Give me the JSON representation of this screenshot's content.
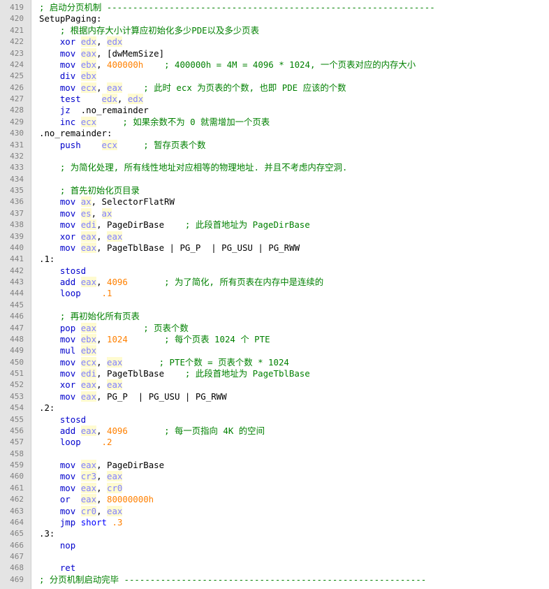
{
  "editor": {
    "title": "",
    "colors": {
      "keyword": "#0000cc",
      "register": "#8080ff",
      "register_bg": "#fffbd0",
      "number": "#ff8000",
      "comment": "#008000",
      "gutter": "#e4e4e4",
      "line_number": "#808080"
    },
    "lines": [
      {
        "n": "419",
        "t": [
          {
            "c": "cmt",
            "v": "; 启动分页机制 ---------------------------------------------------------------"
          }
        ]
      },
      {
        "n": "420",
        "t": [
          {
            "c": "lbl",
            "v": "SetupPaging:"
          }
        ]
      },
      {
        "n": "421",
        "t": [
          {
            "c": "",
            "v": "    "
          },
          {
            "c": "cmt",
            "v": "; 根据内存大小计算应初始化多少PDE以及多少页表"
          }
        ]
      },
      {
        "n": "422",
        "t": [
          {
            "c": "",
            "v": "    "
          },
          {
            "c": "kw",
            "v": "xor"
          },
          {
            "c": "",
            "v": " "
          },
          {
            "c": "reg",
            "v": "edx"
          },
          {
            "c": "",
            "v": ", "
          },
          {
            "c": "reg",
            "v": "edx"
          }
        ]
      },
      {
        "n": "423",
        "t": [
          {
            "c": "",
            "v": "    "
          },
          {
            "c": "kw",
            "v": "mov"
          },
          {
            "c": "",
            "v": " "
          },
          {
            "c": "reg",
            "v": "eax"
          },
          {
            "c": "",
            "v": ", [dwMemSize]"
          }
        ]
      },
      {
        "n": "424",
        "t": [
          {
            "c": "",
            "v": "    "
          },
          {
            "c": "kw",
            "v": "mov"
          },
          {
            "c": "",
            "v": " "
          },
          {
            "c": "reg",
            "v": "ebx"
          },
          {
            "c": "",
            "v": ", "
          },
          {
            "c": "num",
            "v": "400000h"
          },
          {
            "c": "",
            "v": "    "
          },
          {
            "c": "cmt",
            "v": "; 400000h = 4M = 4096 * 1024, 一个页表对应的内存大小"
          }
        ]
      },
      {
        "n": "425",
        "t": [
          {
            "c": "",
            "v": "    "
          },
          {
            "c": "kw",
            "v": "div"
          },
          {
            "c": "",
            "v": " "
          },
          {
            "c": "reg",
            "v": "ebx"
          }
        ]
      },
      {
        "n": "426",
        "t": [
          {
            "c": "",
            "v": "    "
          },
          {
            "c": "kw",
            "v": "mov"
          },
          {
            "c": "",
            "v": " "
          },
          {
            "c": "reg",
            "v": "ecx"
          },
          {
            "c": "",
            "v": ", "
          },
          {
            "c": "reg",
            "v": "eax"
          },
          {
            "c": "",
            "v": "    "
          },
          {
            "c": "cmt",
            "v": "; 此时 ecx 为页表的个数, 也即 PDE 应该的个数"
          }
        ]
      },
      {
        "n": "427",
        "t": [
          {
            "c": "",
            "v": "    "
          },
          {
            "c": "kw",
            "v": "test"
          },
          {
            "c": "",
            "v": "    "
          },
          {
            "c": "reg",
            "v": "edx"
          },
          {
            "c": "",
            "v": ", "
          },
          {
            "c": "reg",
            "v": "edx"
          }
        ]
      },
      {
        "n": "428",
        "t": [
          {
            "c": "",
            "v": "    "
          },
          {
            "c": "kw",
            "v": "jz"
          },
          {
            "c": "",
            "v": "  .no_remainder"
          }
        ]
      },
      {
        "n": "429",
        "t": [
          {
            "c": "",
            "v": "    "
          },
          {
            "c": "kw",
            "v": "inc"
          },
          {
            "c": "",
            "v": " "
          },
          {
            "c": "reg",
            "v": "ecx"
          },
          {
            "c": "",
            "v": "     "
          },
          {
            "c": "cmt",
            "v": "; 如果余数不为 0 就需增加一个页表"
          }
        ]
      },
      {
        "n": "430",
        "t": [
          {
            "c": "lbl",
            "v": ".no_remainder:"
          }
        ]
      },
      {
        "n": "431",
        "t": [
          {
            "c": "",
            "v": "    "
          },
          {
            "c": "kw",
            "v": "push"
          },
          {
            "c": "",
            "v": "    "
          },
          {
            "c": "reg",
            "v": "ecx"
          },
          {
            "c": "",
            "v": "     "
          },
          {
            "c": "cmt",
            "v": "; 暂存页表个数"
          }
        ]
      },
      {
        "n": "432",
        "t": []
      },
      {
        "n": "433",
        "t": [
          {
            "c": "",
            "v": "    "
          },
          {
            "c": "cmt",
            "v": "; 为简化处理, 所有线性地址对应相等的物理地址. 并且不考虑内存空洞."
          }
        ]
      },
      {
        "n": "434",
        "t": []
      },
      {
        "n": "435",
        "t": [
          {
            "c": "",
            "v": "    "
          },
          {
            "c": "cmt",
            "v": "; 首先初始化页目录"
          }
        ]
      },
      {
        "n": "436",
        "t": [
          {
            "c": "",
            "v": "    "
          },
          {
            "c": "kw",
            "v": "mov"
          },
          {
            "c": "",
            "v": " "
          },
          {
            "c": "reg",
            "v": "ax"
          },
          {
            "c": "",
            "v": ", SelectorFlatRW"
          }
        ]
      },
      {
        "n": "437",
        "t": [
          {
            "c": "",
            "v": "    "
          },
          {
            "c": "kw",
            "v": "mov"
          },
          {
            "c": "",
            "v": " "
          },
          {
            "c": "reg",
            "v": "es"
          },
          {
            "c": "",
            "v": ", "
          },
          {
            "c": "reg",
            "v": "ax"
          }
        ]
      },
      {
        "n": "438",
        "t": [
          {
            "c": "",
            "v": "    "
          },
          {
            "c": "kw",
            "v": "mov"
          },
          {
            "c": "",
            "v": " "
          },
          {
            "c": "reg",
            "v": "edi"
          },
          {
            "c": "",
            "v": ", PageDirBase    "
          },
          {
            "c": "cmt",
            "v": "; 此段首地址为 PageDirBase"
          }
        ]
      },
      {
        "n": "439",
        "t": [
          {
            "c": "",
            "v": "    "
          },
          {
            "c": "kw",
            "v": "xor"
          },
          {
            "c": "",
            "v": " "
          },
          {
            "c": "reg",
            "v": "eax"
          },
          {
            "c": "",
            "v": ", "
          },
          {
            "c": "reg",
            "v": "eax"
          }
        ]
      },
      {
        "n": "440",
        "t": [
          {
            "c": "",
            "v": "    "
          },
          {
            "c": "kw",
            "v": "mov"
          },
          {
            "c": "",
            "v": " "
          },
          {
            "c": "reg",
            "v": "eax"
          },
          {
            "c": "",
            "v": ", PageTblBase | PG_P  | PG_USU | PG_RWW"
          }
        ]
      },
      {
        "n": "441",
        "t": [
          {
            "c": "lbl",
            "v": ".1:"
          }
        ]
      },
      {
        "n": "442",
        "t": [
          {
            "c": "",
            "v": "    "
          },
          {
            "c": "kw",
            "v": "stosd"
          }
        ]
      },
      {
        "n": "443",
        "t": [
          {
            "c": "",
            "v": "    "
          },
          {
            "c": "kw",
            "v": "add"
          },
          {
            "c": "",
            "v": " "
          },
          {
            "c": "reg",
            "v": "eax"
          },
          {
            "c": "",
            "v": ", "
          },
          {
            "c": "num",
            "v": "4096"
          },
          {
            "c": "",
            "v": "       "
          },
          {
            "c": "cmt",
            "v": "; 为了简化, 所有页表在内存中是连续的"
          }
        ]
      },
      {
        "n": "444",
        "t": [
          {
            "c": "",
            "v": "    "
          },
          {
            "c": "kw",
            "v": "loop"
          },
          {
            "c": "",
            "v": "    "
          },
          {
            "c": "num",
            "v": ".1"
          }
        ]
      },
      {
        "n": "445",
        "t": []
      },
      {
        "n": "446",
        "t": [
          {
            "c": "",
            "v": "    "
          },
          {
            "c": "cmt",
            "v": "; 再初始化所有页表"
          }
        ]
      },
      {
        "n": "447",
        "t": [
          {
            "c": "",
            "v": "    "
          },
          {
            "c": "kw",
            "v": "pop"
          },
          {
            "c": "",
            "v": " "
          },
          {
            "c": "reg",
            "v": "eax"
          },
          {
            "c": "",
            "v": "         "
          },
          {
            "c": "cmt",
            "v": "; 页表个数"
          }
        ]
      },
      {
        "n": "448",
        "t": [
          {
            "c": "",
            "v": "    "
          },
          {
            "c": "kw",
            "v": "mov"
          },
          {
            "c": "",
            "v": " "
          },
          {
            "c": "reg",
            "v": "ebx"
          },
          {
            "c": "",
            "v": ", "
          },
          {
            "c": "num",
            "v": "1024"
          },
          {
            "c": "",
            "v": "       "
          },
          {
            "c": "cmt",
            "v": "; 每个页表 1024 个 PTE"
          }
        ]
      },
      {
        "n": "449",
        "t": [
          {
            "c": "",
            "v": "    "
          },
          {
            "c": "kw",
            "v": "mul"
          },
          {
            "c": "",
            "v": " "
          },
          {
            "c": "reg",
            "v": "ebx"
          }
        ]
      },
      {
        "n": "450",
        "t": [
          {
            "c": "",
            "v": "    "
          },
          {
            "c": "kw",
            "v": "mov"
          },
          {
            "c": "",
            "v": " "
          },
          {
            "c": "reg",
            "v": "ecx"
          },
          {
            "c": "",
            "v": ", "
          },
          {
            "c": "reg",
            "v": "eax"
          },
          {
            "c": "",
            "v": "       "
          },
          {
            "c": "cmt",
            "v": "; PTE个数 = 页表个数 * 1024"
          }
        ]
      },
      {
        "n": "451",
        "t": [
          {
            "c": "",
            "v": "    "
          },
          {
            "c": "kw",
            "v": "mov"
          },
          {
            "c": "",
            "v": " "
          },
          {
            "c": "reg",
            "v": "edi"
          },
          {
            "c": "",
            "v": ", PageTblBase    "
          },
          {
            "c": "cmt",
            "v": "; 此段首地址为 PageTblBase"
          }
        ]
      },
      {
        "n": "452",
        "t": [
          {
            "c": "",
            "v": "    "
          },
          {
            "c": "kw",
            "v": "xor"
          },
          {
            "c": "",
            "v": " "
          },
          {
            "c": "reg",
            "v": "eax"
          },
          {
            "c": "",
            "v": ", "
          },
          {
            "c": "reg",
            "v": "eax"
          }
        ]
      },
      {
        "n": "453",
        "t": [
          {
            "c": "",
            "v": "    "
          },
          {
            "c": "kw",
            "v": "mov"
          },
          {
            "c": "",
            "v": " "
          },
          {
            "c": "reg",
            "v": "eax"
          },
          {
            "c": "",
            "v": ", PG_P  | PG_USU | PG_RWW"
          }
        ]
      },
      {
        "n": "454",
        "t": [
          {
            "c": "lbl",
            "v": ".2:"
          }
        ]
      },
      {
        "n": "455",
        "t": [
          {
            "c": "",
            "v": "    "
          },
          {
            "c": "kw",
            "v": "stosd"
          }
        ]
      },
      {
        "n": "456",
        "t": [
          {
            "c": "",
            "v": "    "
          },
          {
            "c": "kw",
            "v": "add"
          },
          {
            "c": "",
            "v": " "
          },
          {
            "c": "reg",
            "v": "eax"
          },
          {
            "c": "",
            "v": ", "
          },
          {
            "c": "num",
            "v": "4096"
          },
          {
            "c": "",
            "v": "       "
          },
          {
            "c": "cmt",
            "v": "; 每一页指向 4K 的空间"
          }
        ]
      },
      {
        "n": "457",
        "t": [
          {
            "c": "",
            "v": "    "
          },
          {
            "c": "kw",
            "v": "loop"
          },
          {
            "c": "",
            "v": "    "
          },
          {
            "c": "num",
            "v": ".2"
          }
        ]
      },
      {
        "n": "458",
        "t": []
      },
      {
        "n": "459",
        "t": [
          {
            "c": "",
            "v": "    "
          },
          {
            "c": "kw",
            "v": "mov"
          },
          {
            "c": "",
            "v": " "
          },
          {
            "c": "reg",
            "v": "eax"
          },
          {
            "c": "",
            "v": ", PageDirBase"
          }
        ]
      },
      {
        "n": "460",
        "t": [
          {
            "c": "",
            "v": "    "
          },
          {
            "c": "kw",
            "v": "mov"
          },
          {
            "c": "",
            "v": " "
          },
          {
            "c": "reg",
            "v": "cr3"
          },
          {
            "c": "",
            "v": ", "
          },
          {
            "c": "reg",
            "v": "eax"
          }
        ]
      },
      {
        "n": "461",
        "t": [
          {
            "c": "",
            "v": "    "
          },
          {
            "c": "kw",
            "v": "mov"
          },
          {
            "c": "",
            "v": " "
          },
          {
            "c": "reg",
            "v": "eax"
          },
          {
            "c": "",
            "v": ", "
          },
          {
            "c": "reg",
            "v": "cr0"
          }
        ]
      },
      {
        "n": "462",
        "t": [
          {
            "c": "",
            "v": "    "
          },
          {
            "c": "kw",
            "v": "or"
          },
          {
            "c": "",
            "v": "  "
          },
          {
            "c": "reg",
            "v": "eax"
          },
          {
            "c": "",
            "v": ", "
          },
          {
            "c": "num",
            "v": "80000000h"
          }
        ]
      },
      {
        "n": "463",
        "t": [
          {
            "c": "",
            "v": "    "
          },
          {
            "c": "kw",
            "v": "mov"
          },
          {
            "c": "",
            "v": " "
          },
          {
            "c": "reg",
            "v": "cr0"
          },
          {
            "c": "",
            "v": ", "
          },
          {
            "c": "reg",
            "v": "eax"
          }
        ]
      },
      {
        "n": "464",
        "t": [
          {
            "c": "",
            "v": "    "
          },
          {
            "c": "kw",
            "v": "jmp"
          },
          {
            "c": "",
            "v": " "
          },
          {
            "c": "bt",
            "v": "short"
          },
          {
            "c": "",
            "v": " "
          },
          {
            "c": "num",
            "v": ".3"
          }
        ]
      },
      {
        "n": "465",
        "t": [
          {
            "c": "lbl",
            "v": ".3:"
          }
        ]
      },
      {
        "n": "466",
        "t": [
          {
            "c": "",
            "v": "    "
          },
          {
            "c": "kw",
            "v": "nop"
          }
        ]
      },
      {
        "n": "467",
        "t": []
      },
      {
        "n": "468",
        "t": [
          {
            "c": "",
            "v": "    "
          },
          {
            "c": "kw",
            "v": "ret"
          }
        ]
      },
      {
        "n": "469",
        "t": [
          {
            "c": "cmt",
            "v": "; 分页机制启动完毕 ----------------------------------------------------------"
          }
        ]
      }
    ]
  }
}
